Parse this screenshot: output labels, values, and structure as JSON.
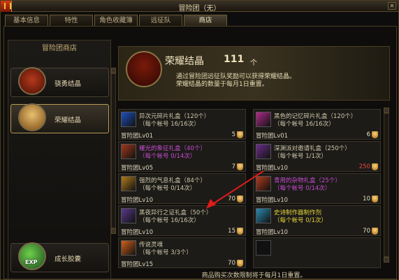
{
  "window": {
    "title": "冒险团（无）"
  },
  "tabs": [
    "基本信息",
    "特性",
    "角色收藏簿",
    "远征队",
    "商店"
  ],
  "sidebar": {
    "title": "冒险团商店",
    "items": [
      {
        "label": "骁勇结晶"
      },
      {
        "label": "荣耀结晶"
      }
    ],
    "bottom": {
      "label": "成长胶囊",
      "badge": "EXP"
    }
  },
  "currency": {
    "name": "荣耀结晶",
    "count": "111",
    "unit": "个",
    "desc": [
      "通过冒险团远征队奖励可以获得荣耀结晶。",
      "荣耀结晶的数量于每月1日重置。"
    ]
  },
  "items": [
    {
      "name": "异次元碎片礼盒（120个）",
      "limit": "（每个帐号 16/16次）",
      "level": "冒险团Lv01",
      "price": "5",
      "color": "#cfc6a8",
      "icon": "#1f4fbf"
    },
    {
      "name": "黑色的记忆碎片礼盒（120个）",
      "limit": "（每个帐号 16/16次）",
      "level": "冒险团Lv01",
      "price": "6",
      "color": "#cfc6a8",
      "icon": "#b02a8a"
    },
    {
      "name": "耀光的象征礼盒（40个）",
      "limit": "（每个帐号 0/14次）",
      "level": "冒险团Lv05",
      "price": "7",
      "color": "#c64bd0",
      "icon": "#a0381c"
    },
    {
      "name": "深渊派对邀请礼盒（250个）",
      "limit": "（每个帐号 1/1次）",
      "level": "冒险团Lv10",
      "price": "250",
      "color": "#cfc6a8",
      "priceColor": "#e84a3a",
      "icon": "#6a2f8a"
    },
    {
      "name": "强烈的气息礼盒（84个）",
      "limit": "（每个帐号 0/14次）",
      "level": "冒险团Lv10",
      "price": "70",
      "color": "#cfc6a8",
      "icon": "#b07a1c"
    },
    {
      "name": "青用的杂物礼盒（25个）",
      "limit": "（每个帐号 0/14次）",
      "level": "冒险团Lv10",
      "price": "10",
      "color": "#c64bd0",
      "icon": "#b03a1c"
    },
    {
      "name": "黑夜异行之证礼盒（50个）",
      "limit": "（每个帐号 16/16次）",
      "level": "冒险团Lv10",
      "price": "15",
      "color": "#cfc6a8",
      "icon": "#5a3a8a"
    },
    {
      "name": "史诗制作器制作剂",
      "limit": "（每个帐号 0/1次）",
      "level": "冒险团Lv10",
      "price": "70",
      "color": "#e3d23a",
      "icon": "#2a8ab0"
    },
    {
      "name": "传说灵魂",
      "limit": "（每个帐号 3/3个）",
      "level": "冒险团Lv15",
      "price": "70",
      "color": "#cfc6a8",
      "icon": "#d0601a"
    }
  ],
  "footer": "商品购买次数限制将于每月1日重置。"
}
